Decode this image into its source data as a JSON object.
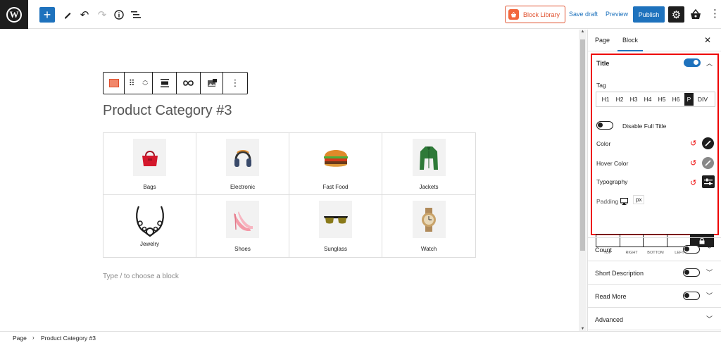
{
  "toolbar": {
    "block_library_label": "Block Library",
    "save_draft_label": "Save draft",
    "preview_label": "Preview",
    "publish_label": "Publish",
    "accent_color": "#1e72bd"
  },
  "editor": {
    "page_title": "Product Category #3",
    "type_hint": "Type / to choose a block",
    "categories": [
      {
        "label": "Bags",
        "icon": "bag-icon"
      },
      {
        "label": "Electronic",
        "icon": "headphones-icon"
      },
      {
        "label": "Fast Food",
        "icon": "burger-icon"
      },
      {
        "label": "Jackets",
        "icon": "jacket-icon"
      },
      {
        "label": "Jewelry",
        "icon": "necklace-icon"
      },
      {
        "label": "Shoes",
        "icon": "heels-icon"
      },
      {
        "label": "Sunglass",
        "icon": "sunglasses-icon"
      },
      {
        "label": "Watch",
        "icon": "watch-icon"
      }
    ]
  },
  "sidebar": {
    "tabs": [
      "Page",
      "Block"
    ],
    "active_tab": "Block",
    "title_panel": {
      "heading": "Title",
      "enabled": true,
      "tag_label": "Tag",
      "tags": [
        "H1",
        "H2",
        "H3",
        "H4",
        "H5",
        "H6",
        "P",
        "DIV"
      ],
      "active_tag": "P",
      "disable_full_title_label": "Disable Full Title",
      "color_label": "Color",
      "hover_color_label": "Hover Color",
      "typography_label": "Typography",
      "padding_label": "Padding",
      "padding_unit": "px",
      "padding_sides": [
        "TOP",
        "RIGHT",
        "BOTTOM",
        "LEFT"
      ]
    },
    "sections": [
      {
        "label": "Count",
        "toggle": true
      },
      {
        "label": "Short Description",
        "toggle": true
      },
      {
        "label": "Read More",
        "toggle": true
      },
      {
        "label": "Advanced",
        "toggle": false
      }
    ]
  },
  "statusbar": {
    "crumb_1": "Page",
    "crumb_2": "Product Category #3"
  }
}
